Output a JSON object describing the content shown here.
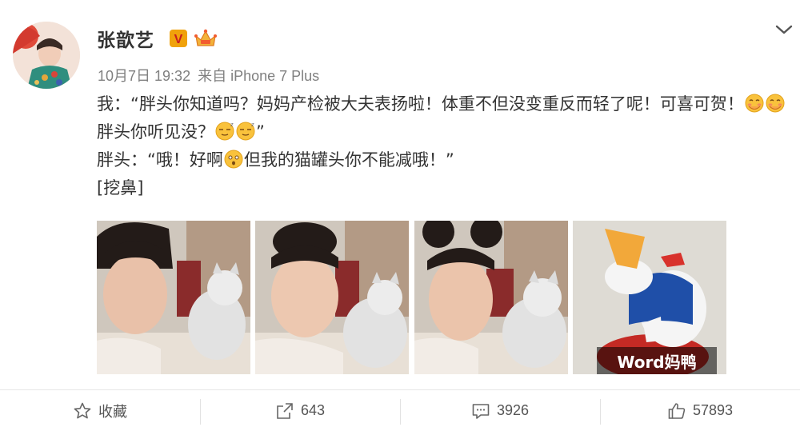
{
  "user": {
    "name": "张歆艺",
    "verified_badge": "V",
    "time": "10月7日 19:32",
    "source": "来自 iPhone 7 Plus"
  },
  "post": {
    "line1_prefix": "我：“胖头你知道吗？妈妈产检被大夫表扬啦！体重不但没变重反而轻了呢！可喜可贺！",
    "line1_mid": "胖头你听见没？",
    "line1_suffix": "”",
    "line2_prefix": "胖头：“哦！好啊",
    "line2_suffix": "但我的猫罐头你不能减哦！”",
    "line3": "[挖鼻]"
  },
  "media": {
    "meme_caption": "Word妈鸭"
  },
  "toolbar": {
    "favorite_label": "收藏",
    "repost_count": "643",
    "comment_count": "3926",
    "like_count": "57893"
  },
  "colors": {
    "badge_orange": "#f0a20b",
    "icon_gray": "#666666",
    "emoji_yellow": "#f9c23c"
  }
}
